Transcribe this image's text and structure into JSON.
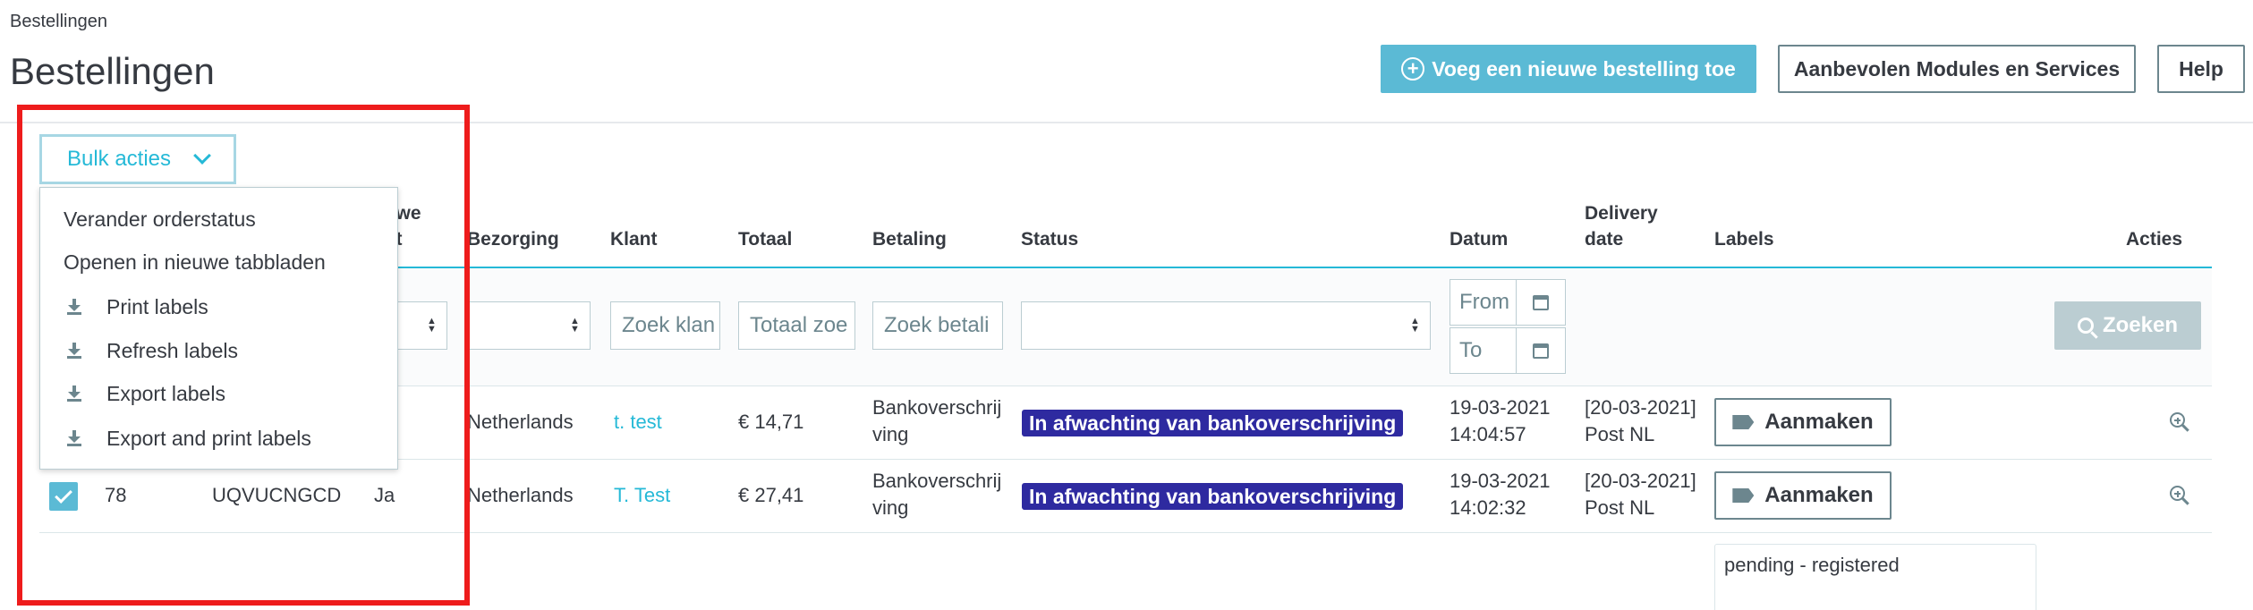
{
  "breadcrumb": "Bestellingen",
  "page_title": "Bestellingen",
  "header_buttons": {
    "add_order": "Voeg een nieuwe bestelling toe",
    "modules": "Aanbevolen Modules en Services",
    "help": "Help"
  },
  "bulk": {
    "label": "Bulk acties",
    "items": [
      "Verander orderstatus",
      "Openen in nieuwe tabbladen",
      "Print labels",
      "Refresh labels",
      "Export labels",
      "Export and print labels"
    ]
  },
  "columns": {
    "nieuwe_klant_1": "euwe",
    "nieuwe_klant_2": "ant",
    "bezorging": "Bezorging",
    "klant": "Klant",
    "totaal": "Totaal",
    "betaling": "Betaling",
    "status": "Status",
    "datum": "Datum",
    "delivery_1": "Delivery",
    "delivery_2": "date",
    "labels": "Labels",
    "acties": "Acties"
  },
  "filters": {
    "klant_placeholder": "Zoek klan",
    "totaal_placeholder": "Totaal zoe",
    "betaling_placeholder": "Zoek betali",
    "date_from": "From",
    "date_to": "To",
    "search_button": "Zoeken"
  },
  "rows": [
    {
      "id": "",
      "reference": "",
      "new_customer": "",
      "delivery": "Netherlands",
      "customer": "t. test",
      "total": "€ 14,71",
      "payment_1": "Bankoverschrij",
      "payment_2": "ving",
      "status": "In afwachting van bankoverschrijving",
      "date_1": "19-03-2021",
      "date_2": "14:04:57",
      "delivery_date_1": "[20-03-2021]",
      "delivery_date_2": "Post NL",
      "label_button": "Aanmaken",
      "checked": false
    },
    {
      "id": "78",
      "reference": "UQVUCNGCD",
      "new_customer": "Ja",
      "delivery": "Netherlands",
      "customer": "T. Test",
      "total": "€ 27,41",
      "payment_1": "Bankoverschrij",
      "payment_2": "ving",
      "status": "In afwachting van bankoverschrijving",
      "date_1": "19-03-2021",
      "date_2": "14:02:32",
      "delivery_date_1": "[20-03-2021]",
      "delivery_date_2": "Post NL",
      "label_button": "Aanmaken",
      "checked": true
    }
  ],
  "row3": {
    "label_status": "pending - registered"
  },
  "colors": {
    "accent": "#25b9d7",
    "primary_button": "#5bbad5",
    "status_badge": "#2e2aa0",
    "highlight": "#ee1c1c"
  }
}
